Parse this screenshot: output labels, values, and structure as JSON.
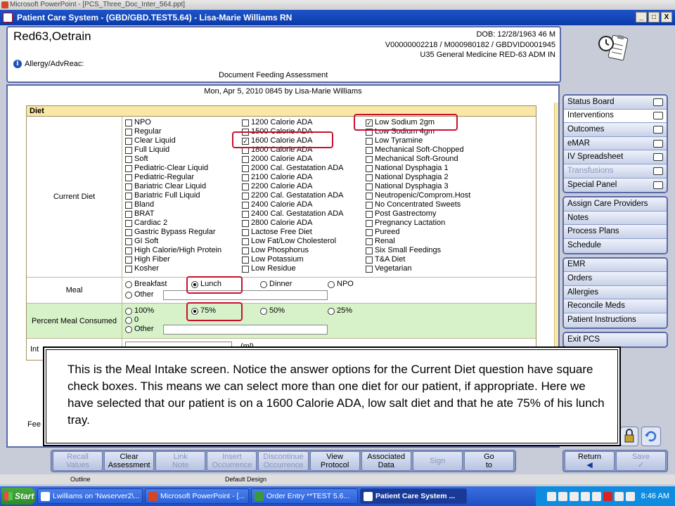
{
  "ppt_window": {
    "title": "Microsoft PowerPoint - [PCS_Three_Doc_Inter_564.ppt]"
  },
  "app_window": {
    "title": "Patient Care System - (GBD/GBD.TEST5.64) - Lisa-Marie Williams RN",
    "buttons": [
      "_",
      "□",
      "X"
    ]
  },
  "patient": {
    "name": "Red63,Oetrain",
    "dob": "DOB: 12/28/1963 46 M",
    "ids": "V00000002218 / M000980182 / GBDVID0001945",
    "location": "U35 General Medicine  RED-63  ADM IN",
    "allergy_label": "Allergy/AdvReac:",
    "document_title": "Document Feeding Assessment"
  },
  "form": {
    "date_line": "Mon,  Apr 5, 2010 0845   by  Lisa-Marie Williams",
    "section": "Diet",
    "current_diet_label": "Current Diet",
    "diet_col1": [
      "NPO",
      "Regular",
      "Clear Liquid",
      "Full Liquid",
      "Soft",
      "Pediatric-Clear Liquid",
      "Pediatric-Regular",
      "Bariatric Clear Liquid",
      "Bariatric Full Liquid",
      "Bland",
      "BRAT",
      "Cardiac 2",
      "Gastric Bypass Regular",
      "GI Soft",
      "High Calorie/High Protein",
      "High Fiber",
      "Kosher"
    ],
    "diet_col2": [
      "1200 Calorie ADA",
      "1500 Calorie ADA",
      "1600 Calorie ADA",
      "1800 Calorie ADA",
      "2000 Calorie ADA",
      "2000 Cal. Gestatation ADA",
      "2100 Calorie ADA",
      "2200 Calorie ADA",
      "2200 Cal. Gestatation ADA",
      "2400 Calorie ADA",
      "2400 Cal. Gestatation ADA",
      "2800 Calorie ADA",
      "Lactose Free Diet",
      "Low Fat/Low Cholesterol",
      "Low Phosphorus",
      "Low Potassium",
      "Low Residue"
    ],
    "diet_col3": [
      "Low Sodium 2gm",
      "Low Sodium 4gm",
      "Low Tyramine",
      "Mechanical Soft-Chopped",
      "Mechanical Soft-Ground",
      "National Dysphagia 1",
      "National Dysphagia 2",
      "National Dysphagia 3",
      "Neutropenic/Comprom.Host",
      "No Concentrated Sweets",
      "Post Gastrectomy",
      "Pregnancy Lactation",
      "Pureed",
      "Renal",
      "Six Small Feedings",
      "T&A Diet",
      "Vegetarian"
    ],
    "checked": {
      "col2": 2,
      "col3": 0
    },
    "meal_label": "Meal",
    "meal_options": [
      "Breakfast",
      "Lunch",
      "Dinner",
      "NPO"
    ],
    "meal_other": "Other",
    "meal_selected": "Lunch",
    "percent_label": "Percent Meal Consumed",
    "percent_options": [
      "100%",
      "75%",
      "50%",
      "25%"
    ],
    "percent_zero": "0",
    "percent_other": "Other",
    "percent_selected": "75%",
    "intake_label_fragment": "Int",
    "intake_unit": "(ml)",
    "fee_fragment": "Fee"
  },
  "nav": {
    "group1": [
      {
        "label": "Status Board",
        "icon": "status-board-icon"
      },
      {
        "label": "Interventions",
        "icon": "interventions-icon"
      },
      {
        "label": "Outcomes",
        "icon": "outcomes-icon"
      },
      {
        "label": "eMAR",
        "icon": "emar-icon"
      },
      {
        "label": "IV Spreadsheet",
        "icon": "iv-spreadsheet-icon"
      },
      {
        "label": "Transfusions",
        "icon": "transfusions-icon"
      },
      {
        "label": "Special Panel",
        "icon": "special-panel-icon"
      }
    ],
    "group2": [
      "Assign Care Providers",
      "Notes",
      "Process Plans",
      "Schedule"
    ],
    "group3": [
      "EMR",
      "Orders",
      "Allergies",
      "Reconcile Meds",
      "Patient Instructions"
    ],
    "group4": [
      "Exit PCS"
    ]
  },
  "callout": {
    "text": "This is the Meal Intake screen. Notice the answer options for the Current Diet question have square check boxes. This means we can select more than one diet for our patient, if appropriate. Here we have selected that our patient is on a 1600 Calorie ADA, low salt diet and that he ate 75% of his lunch tray."
  },
  "toolbar": [
    {
      "label": "Recall Values",
      "enabled": false
    },
    {
      "label": "Clear Assessment",
      "enabled": true
    },
    {
      "label": "Link Note",
      "enabled": false
    },
    {
      "label": "Insert Occurrence",
      "enabled": false
    },
    {
      "label": "Discontinue Occurrence",
      "enabled": false
    },
    {
      "label": "View Protocol",
      "enabled": true
    },
    {
      "label": "Associated Data",
      "enabled": true
    },
    {
      "label": "Sign",
      "enabled": false
    },
    {
      "label": "Go to",
      "enabled": true
    }
  ],
  "return_save": [
    {
      "label": "Return",
      "enabled": true
    },
    {
      "label": "Save",
      "enabled": false
    }
  ],
  "ppt_status": {
    "outline": "Outline",
    "design": "Default Design"
  },
  "taskbar": {
    "start": "Start",
    "tasks": [
      "Lwilliams on 'Nwserver2\\...",
      "Microsoft PowerPoint - [...",
      "Order Entry **TEST 5.6...",
      "Patient Care System ..."
    ],
    "time": "8:46 AM"
  },
  "colors": {
    "accent": "#1f4fb4",
    "highlight": "#c8102e",
    "diet_header": "#f8e7a5",
    "green_row": "#d7f2c8"
  }
}
